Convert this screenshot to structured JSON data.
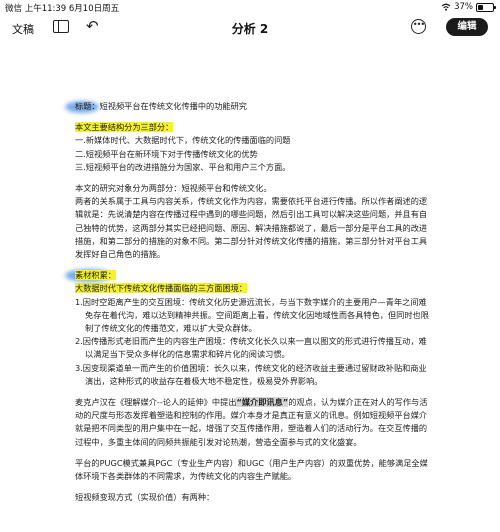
{
  "status_bar": {
    "left": "微信  上午11:39  6月10日周五",
    "battery_label": "37%",
    "battery_level": 0.37
  },
  "toolbar": {
    "back_label": "文稿",
    "title": "分析 2",
    "more_label": "•••",
    "edit_label": "编辑"
  },
  "icons": {
    "sidebar": "sidebar-toggle-icon",
    "undo": "undo-icon",
    "more": "more-circle-icon",
    "wifi": "wifi-icon",
    "battery": "battery-icon"
  },
  "colors": {
    "highlight_yellow": "#f4f12e",
    "tag_blue": "#4b8fe0",
    "edit_button": "#1b1b1b"
  },
  "doc": {
    "title": "标题：短视频平台在传统文化传播中的功能研究",
    "structure_heading": "本文主要结构分为三部分：",
    "structure_items": [
      "一.新媒体时代、大数据时代下，传统文化的传播面临的问题",
      "二.短视频平台在新环境下对于传播传统文化的优势",
      "三.短视频平台的改进措施分为国家、平台和用户三个方面。"
    ],
    "intro_line": "本文的研究对象分为两部分：短视频平台和传统文化。",
    "intro_para": "两者的关系属于工具与内容关系，传统文化作为内容，需要依托平台进行传播。所以作者阐述的逻辑就是：先说清楚内容在传播过程中遇到的哪些问题，然后引出工具可以解决这些问题，并且有自己独特的优势，这两部分其实已经把问题、原因、解决措施都说了，最后一部分是平台工具的改进措施，和第二部分的措施的对象不同。第二部分针对传统文化传播的措施，第三部分针对平台工具发挥好自己角色的措施。",
    "material_tag": "素材积累：",
    "material_heading": "大数据时代下传统文化传播面临的三方面困境：",
    "material_items": [
      "1.因时空距离产生的交互困境：传统文化历史源远流长，与当下数字媒介的主要用户—青年之间难免存在着代沟，难以达到精神共振。空间距离上看，传统文化因地域性而各具特色，但同时也限制了传统文化的传播范文，难以扩大受众群体。",
      "2.因传播形式老旧而产生的内容生产困境：传统文化长久以来一直以图文的形式进行传播互动，难以满足当下受众多样化的信息需求和碎片化的阅读习惯。",
      "3.因变现渠道单一而产生的价值困境：长久以来，传统文化的经济收益主要通过留财政补贴和商业演出，这种形式的收益存在着极大地不稳定性，极易受外界影响。"
    ],
    "mcluhan_before": "麦克卢汉在《理解媒介--论人的延伸》中提出",
    "mcluhan_quote": "“媒介即讯息”",
    "mcluhan_after": "的观点，认为媒介正在对人的写作与活动的尺度与形态发挥着塑造和控制的作用。媒介本身才是真正有意义的讯息。例如短视频平台媒介就是把不同类型的用户集中在一起，增强了交互传播作用，塑造着人们的活动行为。在交互传播的过程中，多重主体间的同频共振能引发对论热潮，营造全面参与式的文化盛宴。",
    "platform_para": "平台的PUGC模式兼具PGC（专业生产内容）和UGC（用户生产内容）的双重优势，能够满足全媒体环境下各类群体的不同需求，为传统文化的内容生产赋能。",
    "value_heading": "短视频变现方式（实现价值）有两种："
  }
}
